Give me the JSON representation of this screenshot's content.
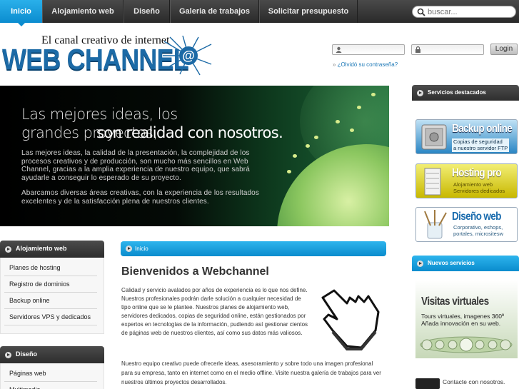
{
  "nav": {
    "items": [
      {
        "label": "Inicio",
        "active": true
      },
      {
        "label": "Alojamiento web"
      },
      {
        "label": "Diseño"
      },
      {
        "label": "Galeria de trabajos"
      },
      {
        "label": "Solicitar presupuesto"
      }
    ],
    "search_placeholder": "buscar..."
  },
  "header": {
    "tagline": "El canal creativo de internet",
    "brand": "WEB CHANNEL",
    "login_button": "Login",
    "forgot_link": "¿Olvidó su contraseña?"
  },
  "hero": {
    "headline_plain": "Las mejores ideas, los grandes proyectos,",
    "headline_bold": "son realidad con nosotros.",
    "paragraph1": "Las mejores ideas, la calidad de la presentación, la complejidad de los procesos creativos y de producción, son mucho más sencillos en Web Channel, gracias a la amplia experiencia de nuestro equipo, que sabrá ayudarle a conseguir lo esperado de su proyecto.",
    "paragraph2": "Abarcamos diversas áreas creativas, con la experiencia de los resultados excelentes y de la satisfacción plena de nuestros clientes."
  },
  "sidebar": {
    "sections": [
      {
        "title": "Alojamiento web",
        "items": [
          "Planes de hosting",
          "Registro de dominios",
          "Backup online",
          "Servidores VPS y dedicados"
        ]
      },
      {
        "title": "Diseño",
        "items": [
          "Páginas web",
          "Multimedia"
        ]
      }
    ]
  },
  "main": {
    "breadcrumb": "Inicio",
    "title": "Bienvenidos a Webchannel",
    "paragraph1": "Calidad y servicio avalados por años de experiencia es lo que nos define. Nuestros profesionales podrán darle solución a cualquier necesidad de tipo online que se le plantee. Nuestros planes de alojamiento web, servidores dedicados, copias de seguridad online, están gestionados por expertos en tecnologías de la información, pudiendo así gestionar cientos de páginas web de nuestros clientes, así como sus datos más valiosos.",
    "paragraph2": "Nuestro equipo creativo puede ofrecerle ideas, asesoramiento y sobre todo una imagen profesional para su empresa, tanto en internet como en el medio offline. Visite nuestra galería de trabajos para ver nuestros últimos proyectos desarrollados."
  },
  "right": {
    "featured_title": "Servicios destacados",
    "promos": [
      {
        "title": "Backup online",
        "lines": [
          "Copias de seguridad",
          "a nuestro servidor FTP"
        ]
      },
      {
        "title": "Hosting pro",
        "lines": [
          "Alojamiento web",
          "Servidores dedicados"
        ]
      },
      {
        "title": "Diseño web",
        "lines": [
          "Corporativo, eshops,",
          "portales, micrositesw"
        ]
      }
    ],
    "new_title": "Nuevos servicios",
    "virtual": {
      "title": "Visitas virtuales",
      "lines": [
        "Tours virtuales, imagenes 360º",
        "Añada innovación en su web."
      ]
    },
    "contact": "Contacte con nosotros."
  },
  "colors": {
    "accent": "#0a8ccd",
    "nav_dark": "#2a2a2a",
    "brand_blue": "#1c6aa6"
  }
}
